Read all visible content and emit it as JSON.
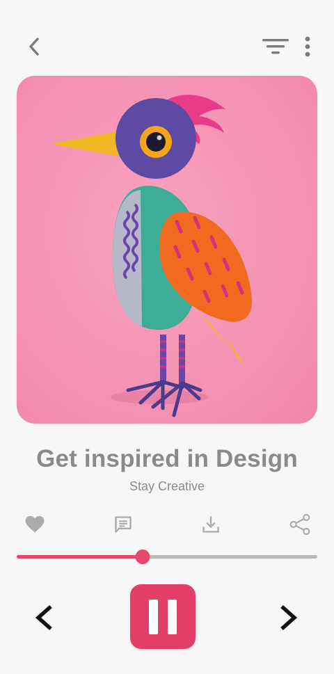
{
  "header": {
    "back_icon": "chevron-left-icon",
    "filter_icon": "filter-icon",
    "more_icon": "more-vertical-icon"
  },
  "artwork": {
    "subject": "colorful-bird-illustration",
    "background_color": "#f48fb1"
  },
  "track": {
    "title": "Get inspired in Design",
    "subtitle": "Stay Creative"
  },
  "actions": [
    {
      "name": "like",
      "icon": "heart-icon"
    },
    {
      "name": "comment",
      "icon": "comment-icon"
    },
    {
      "name": "download",
      "icon": "download-icon"
    },
    {
      "name": "share",
      "icon": "share-icon"
    }
  ],
  "player": {
    "progress": 0.42,
    "accent_color": "#e23e66",
    "state": "playing",
    "prev_icon": "chevron-left-icon",
    "pause_icon": "pause-icon",
    "next_icon": "chevron-right-icon"
  }
}
